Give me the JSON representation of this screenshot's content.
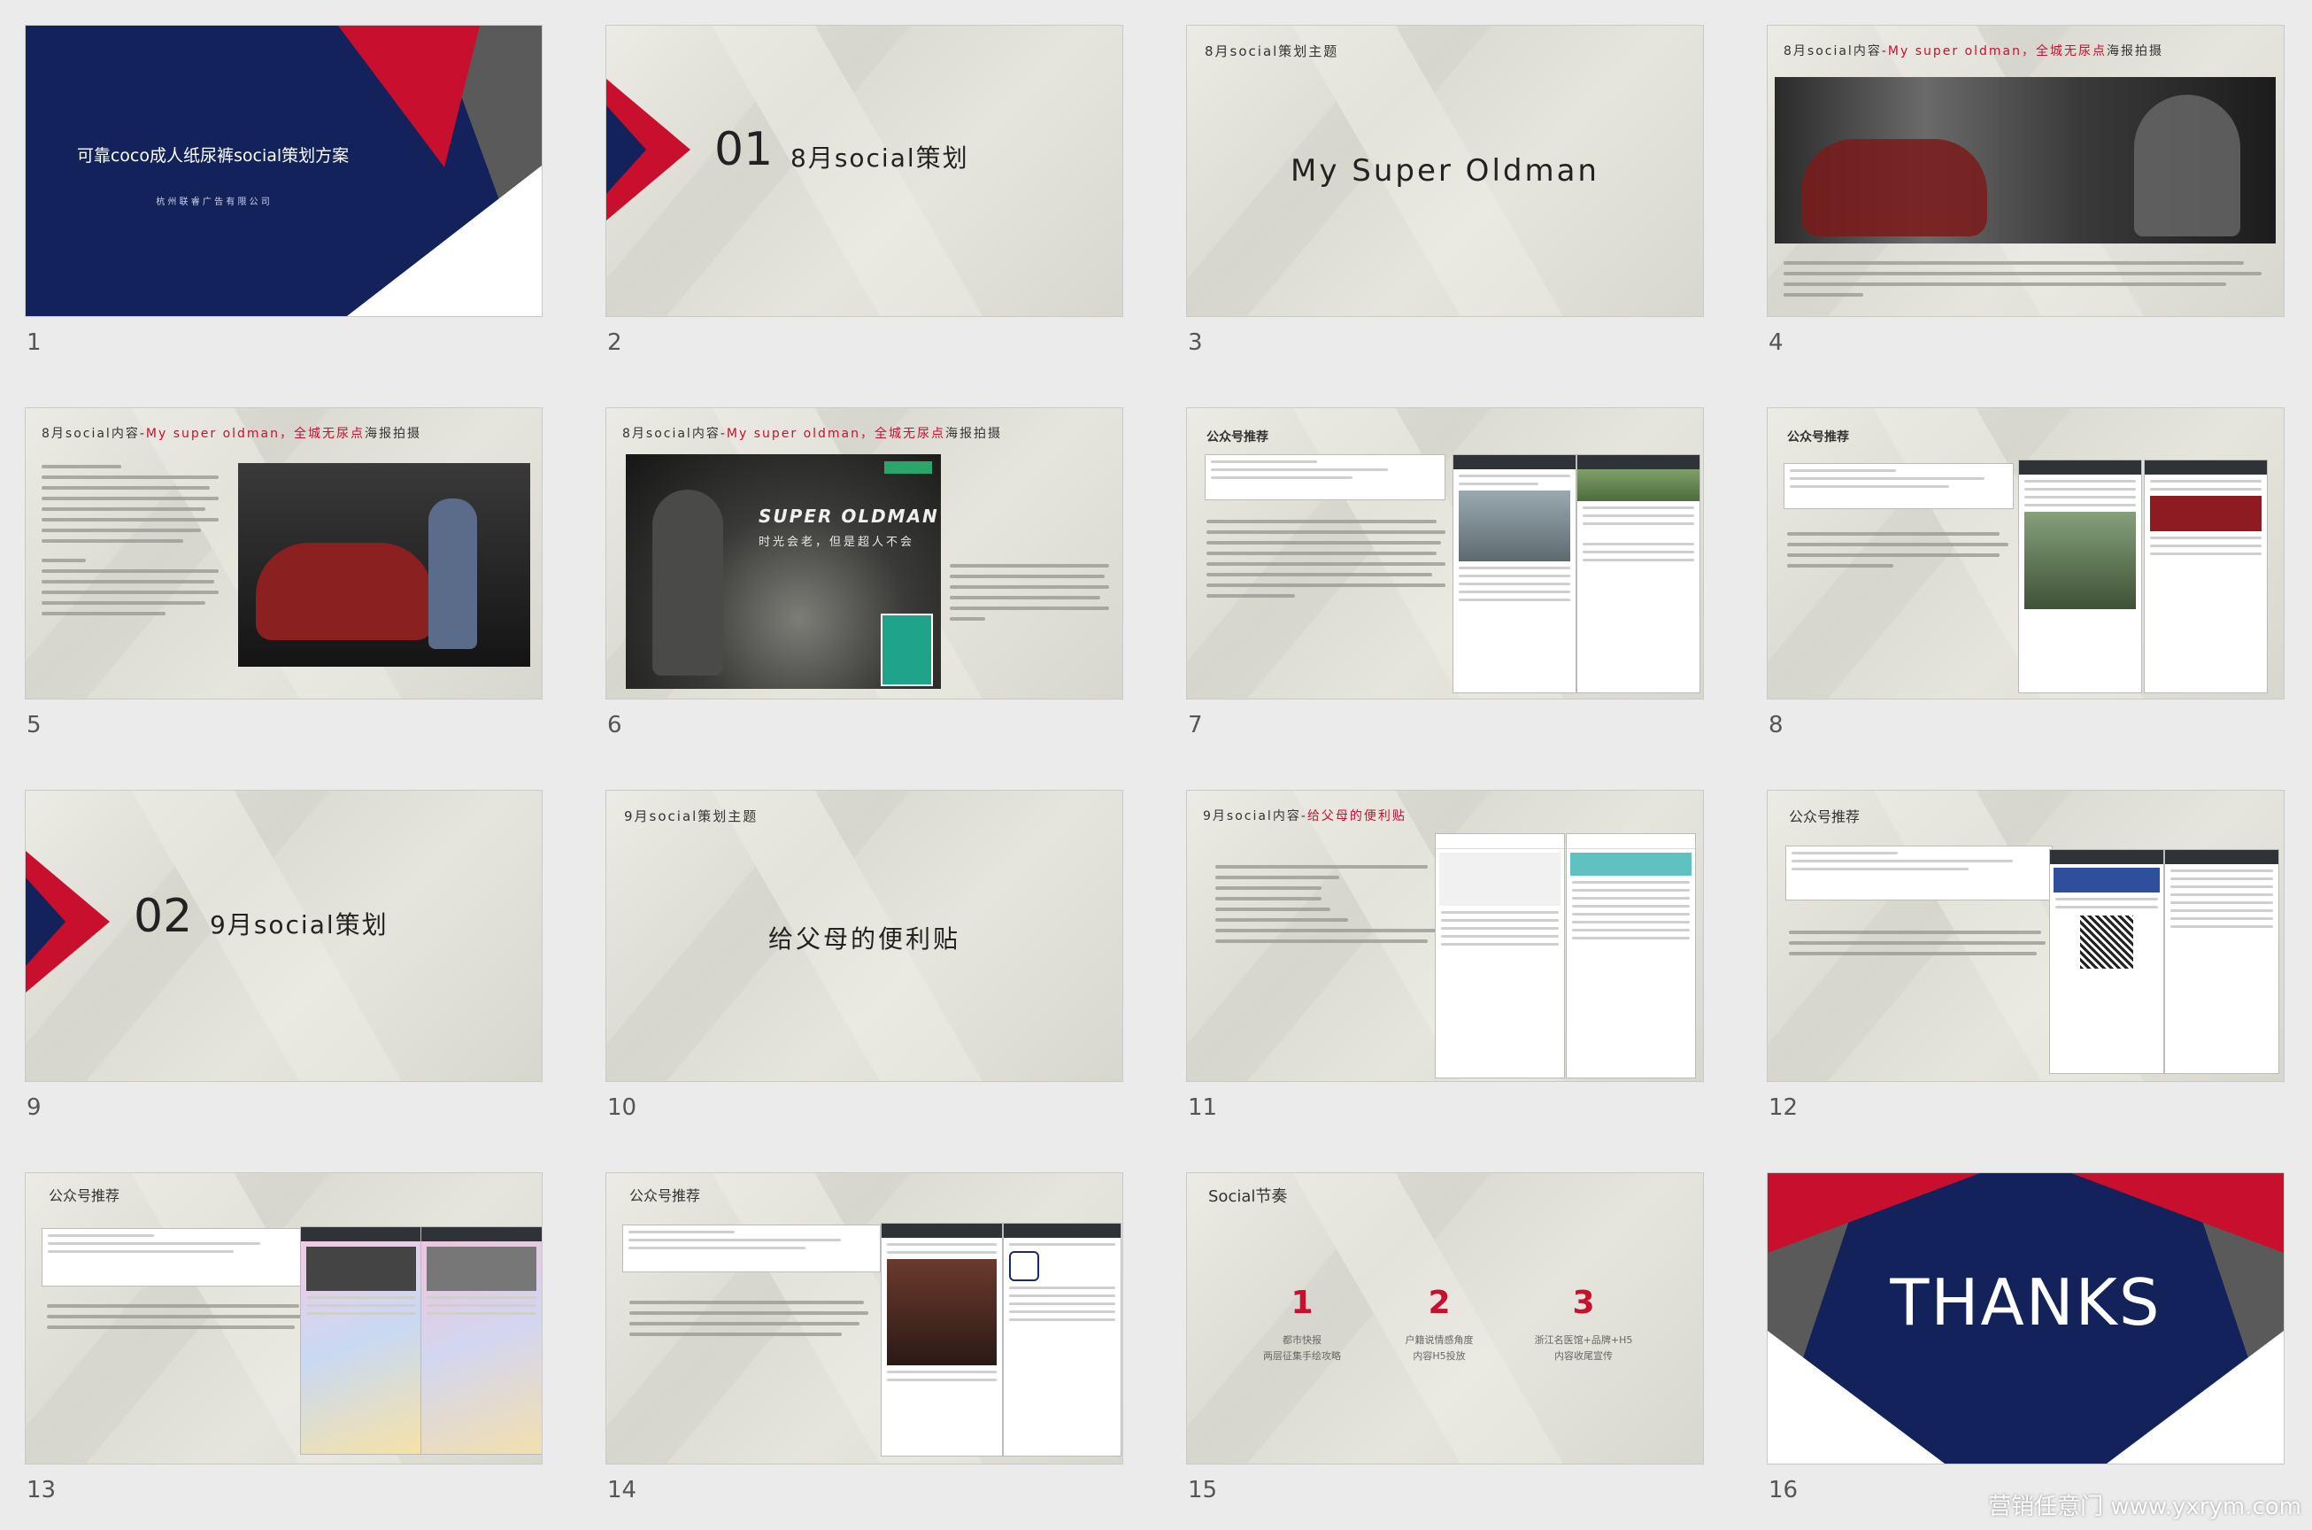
{
  "colors": {
    "navy": "#13225a",
    "red": "#c8102e",
    "gray": "#5a5a5a"
  },
  "slides": [
    {
      "n": "1",
      "title": "可靠coco成人纸尿裤social策划方案",
      "sub": "杭 州 联 睿 广 告 有 限 公 司"
    },
    {
      "n": "2",
      "num": "01",
      "title": "8月social策划"
    },
    {
      "n": "3",
      "header": "8月social策划主题",
      "main": "My Super Oldman"
    },
    {
      "n": "4",
      "header_a": "8月social内容-",
      "header_b": "My super oldman，全城无尿点",
      "header_c": "海报拍摄"
    },
    {
      "n": "5",
      "header_a": "8月social内容-",
      "header_b": "My super oldman，全城无尿点",
      "header_c": "海报拍摄"
    },
    {
      "n": "6",
      "header_a": "8月social内容-",
      "header_b": "My super oldman，全城无尿点",
      "header_c": "海报拍摄",
      "poster_title": "SUPER OLDMAN",
      "poster_sub": "时光会老，但是超人不会"
    },
    {
      "n": "7",
      "header": "公众号推荐"
    },
    {
      "n": "8",
      "header": "公众号推荐"
    },
    {
      "n": "9",
      "num": "02",
      "title": "9月social策划"
    },
    {
      "n": "10",
      "header": "9月social策划主题",
      "main": "给父母的便利贴"
    },
    {
      "n": "11",
      "header_a": "9月social内容-",
      "header_b": "给父母的便利贴"
    },
    {
      "n": "12",
      "header": "公众号推荐"
    },
    {
      "n": "13",
      "header": "公众号推荐"
    },
    {
      "n": "14",
      "header": "公众号推荐"
    },
    {
      "n": "15",
      "header": "Social节奏",
      "items": [
        {
          "num": "1",
          "l1": "都市快报",
          "l2": "两层征集手绘攻略"
        },
        {
          "num": "2",
          "l1": "户籍说情感角度",
          "l2": "内容H5投放"
        },
        {
          "num": "3",
          "l1": "浙江名医馆+品牌+H5",
          "l2": "内容收尾宣传"
        }
      ]
    },
    {
      "n": "16",
      "main": "THANKS"
    }
  ],
  "watermark": "营销任意门 www.yxrym.com"
}
